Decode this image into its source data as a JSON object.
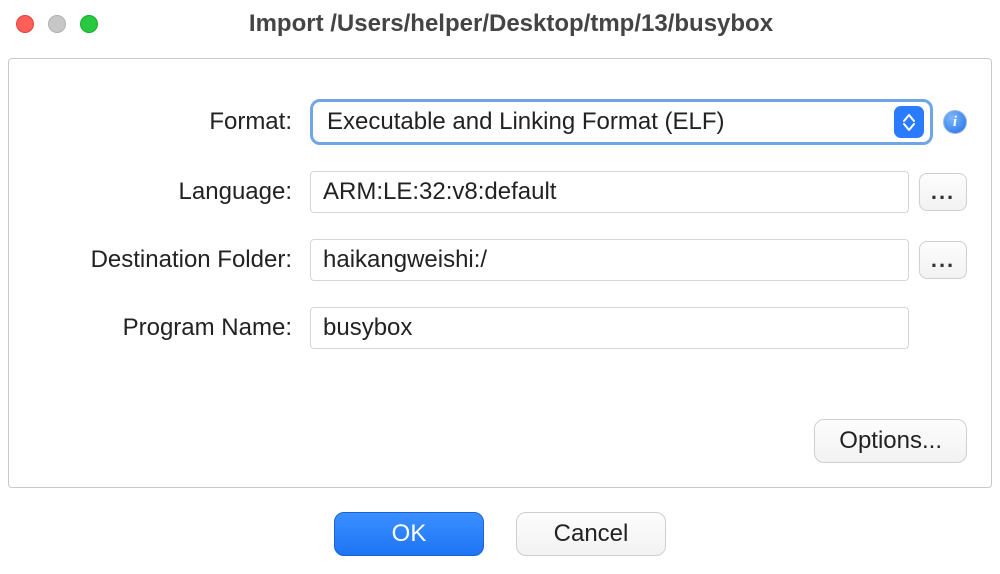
{
  "window": {
    "title": "Import /Users/helper/Desktop/tmp/13/busybox"
  },
  "form": {
    "format": {
      "label": "Format:",
      "value": "Executable and Linking Format (ELF)"
    },
    "language": {
      "label": "Language:",
      "value": "ARM:LE:32:v8:default"
    },
    "destination": {
      "label": "Destination Folder:",
      "value": "haikangweishi:/"
    },
    "program_name": {
      "label": "Program Name:",
      "value": "busybox"
    }
  },
  "buttons": {
    "browse": "...",
    "options": "Options...",
    "ok": "OK",
    "cancel": "Cancel"
  }
}
